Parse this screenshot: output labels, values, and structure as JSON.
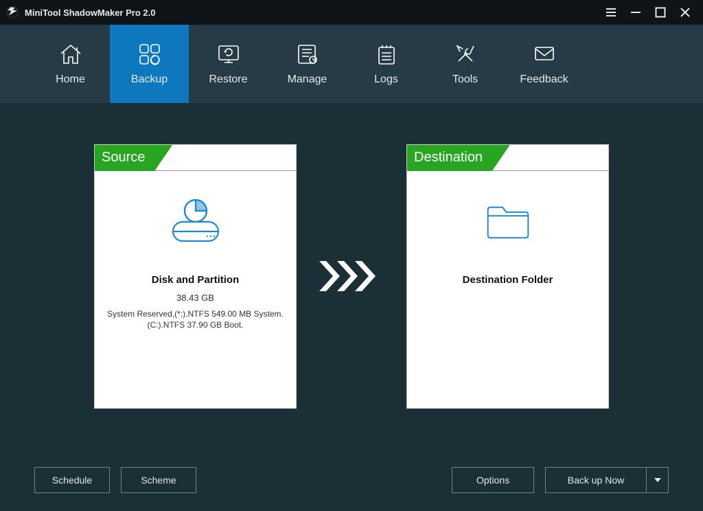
{
  "app": {
    "title": "MiniTool ShadowMaker Pro 2.0"
  },
  "nav": {
    "items": [
      {
        "id": "home",
        "label": "Home"
      },
      {
        "id": "backup",
        "label": "Backup"
      },
      {
        "id": "restore",
        "label": "Restore"
      },
      {
        "id": "manage",
        "label": "Manage"
      },
      {
        "id": "logs",
        "label": "Logs"
      },
      {
        "id": "tools",
        "label": "Tools"
      },
      {
        "id": "feedback",
        "label": "Feedback"
      }
    ],
    "active": "backup"
  },
  "source_panel": {
    "header": "Source",
    "title": "Disk and Partition",
    "size": "38.43 GB",
    "details_line1": "System Reserved,(*:).NTFS 549.00 MB System.",
    "details_line2": "(C:).NTFS 37.90 GB Boot."
  },
  "destination_panel": {
    "header": "Destination",
    "title": "Destination Folder"
  },
  "buttons": {
    "schedule": "Schedule",
    "scheme": "Scheme",
    "options": "Options",
    "backup_now": "Back up Now"
  }
}
